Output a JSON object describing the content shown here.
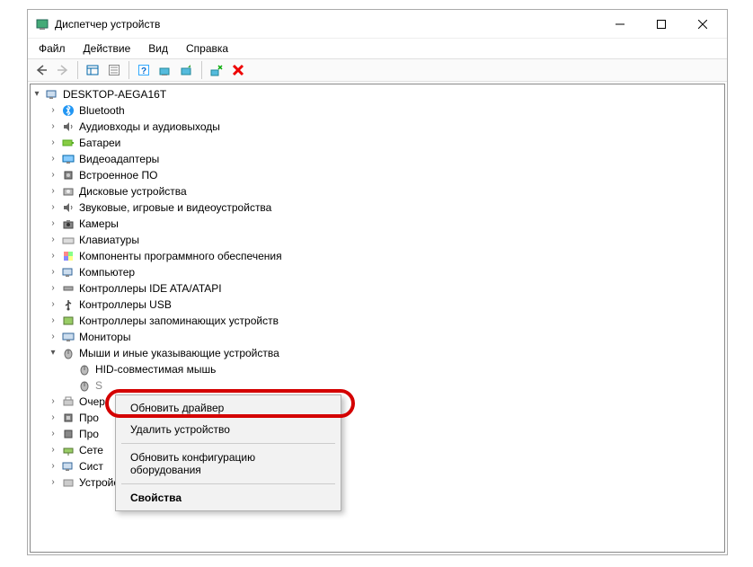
{
  "window": {
    "title": "Диспетчер устройств"
  },
  "menu": {
    "file": "Файл",
    "action": "Действие",
    "view": "Вид",
    "help": "Справка"
  },
  "tree": {
    "root": "DESKTOP-AEGA16T",
    "bluetooth": "Bluetooth",
    "audio": "Аудиовходы и аудиовыходы",
    "batteries": "Батареи",
    "display": "Видеоадаптеры",
    "firmware": "Встроенное ПО",
    "disk": "Дисковые устройства",
    "sound": "Звуковые, игровые и видеоустройства",
    "cameras": "Камеры",
    "keyboards": "Клавиатуры",
    "software": "Компоненты программного обеспечения",
    "computer": "Компьютер",
    "ide": "Контроллеры IDE ATA/ATAPI",
    "usb": "Контроллеры USB",
    "storage": "Контроллеры запоминающих устройств",
    "monitors": "Мониторы",
    "mice": "Мыши и иные указывающие устройства",
    "hid_mouse": "HID-совместимая мышь",
    "touchpad_prefix": "S",
    "print_queues": "Очер",
    "processors": "Про",
    "security_devices": "Про",
    "network": "Сете",
    "system": "Сист",
    "hid": "Устройства HID (Human Interface Devices)"
  },
  "context_menu": {
    "update": "Обновить драйвер",
    "uninstall": "Удалить устройство",
    "scan": "Обновить конфигурацию оборудования",
    "properties": "Свойства"
  }
}
